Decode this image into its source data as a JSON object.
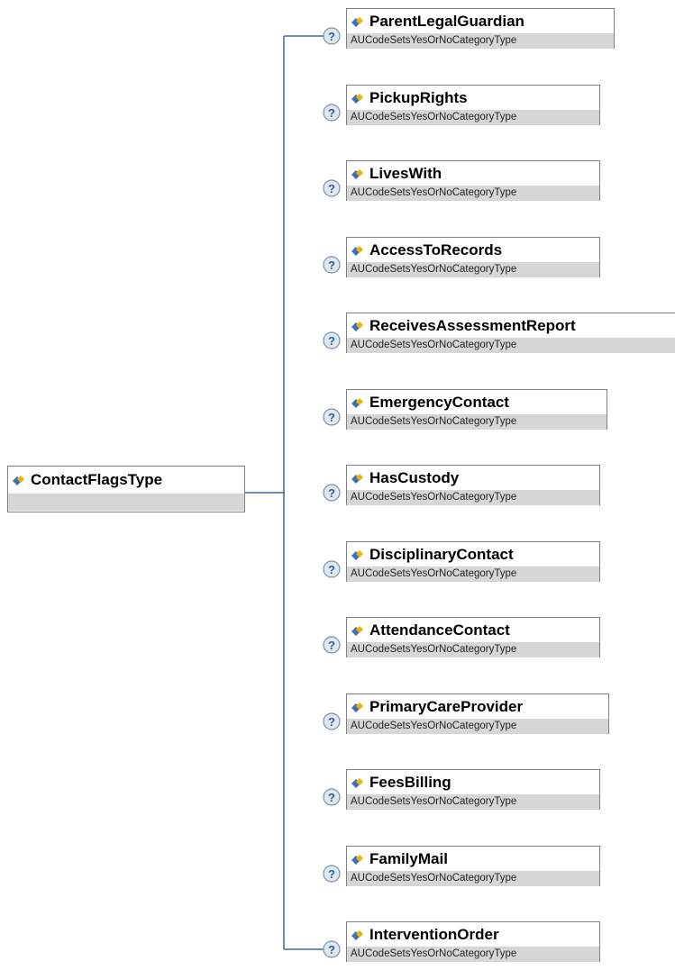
{
  "root": {
    "name": "ContactFlagsType",
    "type": ""
  },
  "children": [
    {
      "name": "ParentLegalGuardian",
      "type": "AUCodeSetsYesOrNoCategoryType"
    },
    {
      "name": "PickupRights",
      "type": "AUCodeSetsYesOrNoCategoryType"
    },
    {
      "name": "LivesWith",
      "type": "AUCodeSetsYesOrNoCategoryType"
    },
    {
      "name": "AccessToRecords",
      "type": "AUCodeSetsYesOrNoCategoryType"
    },
    {
      "name": "ReceivesAssessmentReport",
      "type": "AUCodeSetsYesOrNoCategoryType"
    },
    {
      "name": "EmergencyContact",
      "type": "AUCodeSetsYesOrNoCategoryType"
    },
    {
      "name": "HasCustody",
      "type": "AUCodeSetsYesOrNoCategoryType"
    },
    {
      "name": "DisciplinaryContact",
      "type": "AUCodeSetsYesOrNoCategoryType"
    },
    {
      "name": "AttendanceContact",
      "type": "AUCodeSetsYesOrNoCategoryType"
    },
    {
      "name": "PrimaryCareProvider",
      "type": "AUCodeSetsYesOrNoCategoryType"
    },
    {
      "name": "FeesBilling",
      "type": "AUCodeSetsYesOrNoCategoryType"
    },
    {
      "name": "FamilyMail",
      "type": "AUCodeSetsYesOrNoCategoryType"
    },
    {
      "name": "InterventionOrder",
      "type": "AUCodeSetsYesOrNoCategoryType"
    }
  ],
  "icons": {
    "element": "element-icon",
    "optional": "optional-question-icon"
  },
  "colors": {
    "connector": "#1f4e8c",
    "type_band": "#d6d6d6",
    "border": "#7f7f7f"
  }
}
